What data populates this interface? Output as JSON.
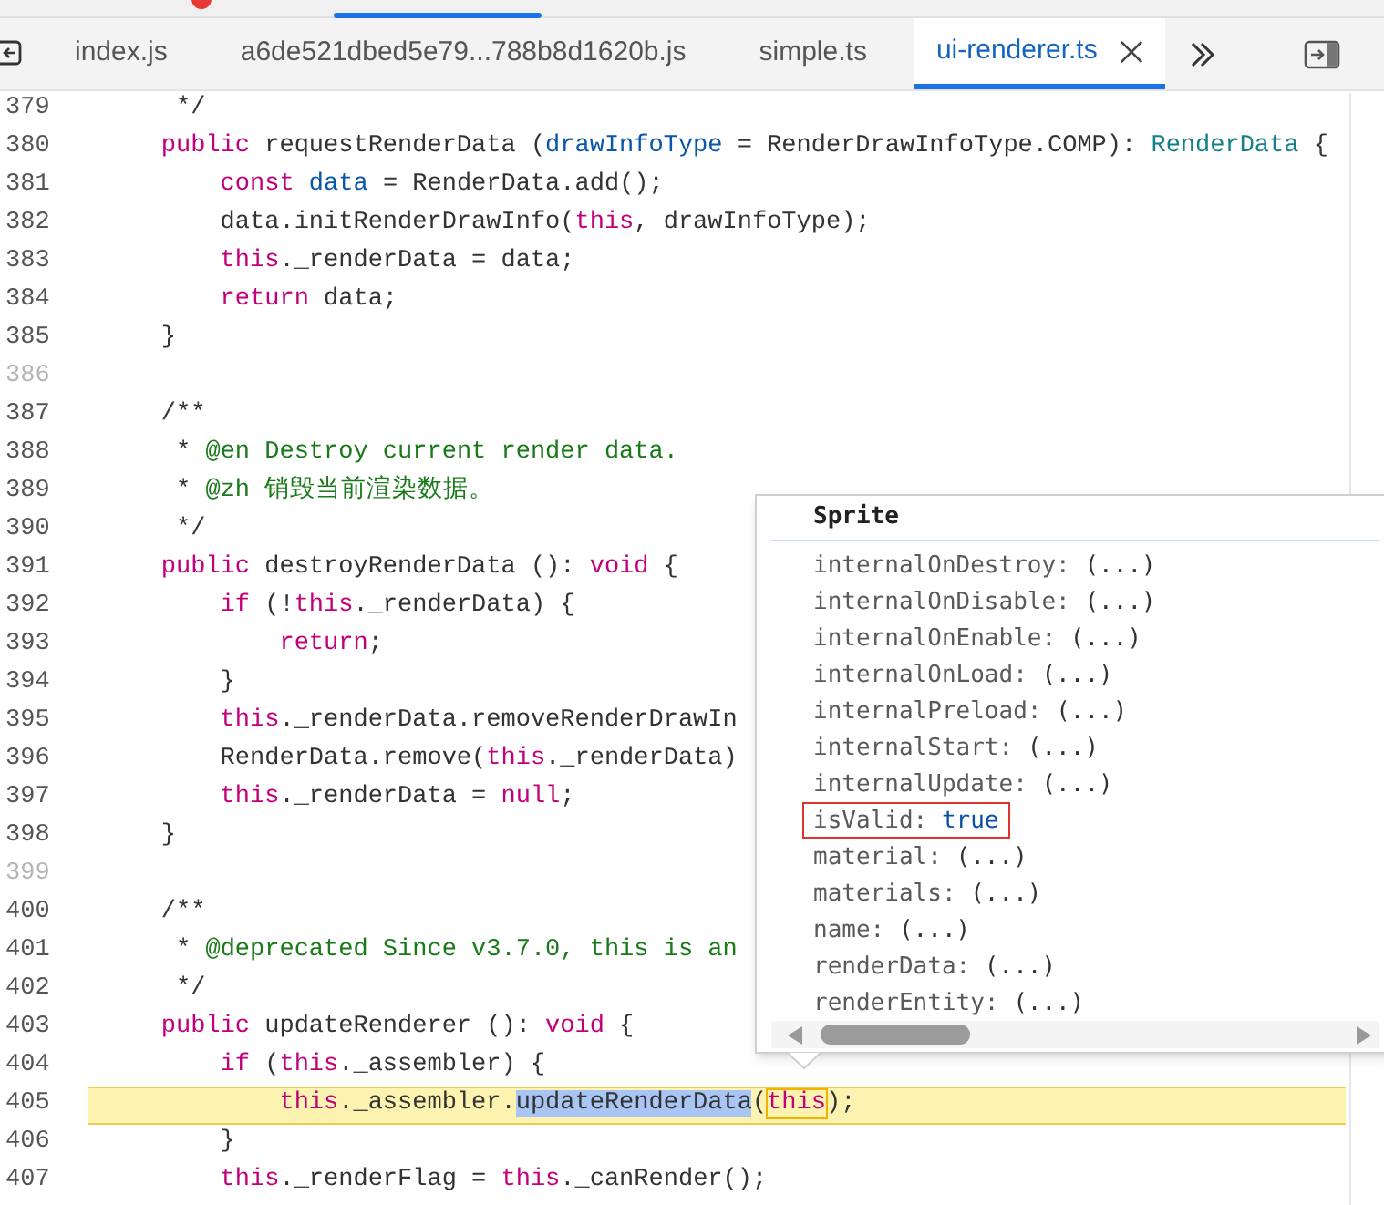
{
  "tab_bar": {
    "tabs": [
      {
        "label": "index.js",
        "selected": false
      },
      {
        "label": "a6de521dbed5e79...788b8d1620b.js",
        "selected": false
      },
      {
        "label": "simple.ts",
        "selected": false
      },
      {
        "label": "ui-renderer.ts",
        "selected": true
      }
    ]
  },
  "editor": {
    "lines": [
      {
        "number": "379",
        "highlighted": false,
        "tokens": [
          {
            "kind": "plain",
            "text": "     */"
          }
        ]
      },
      {
        "number": "380",
        "highlighted": false,
        "tokens": [
          {
            "kind": "keyword",
            "text": "    public"
          },
          {
            "kind": "plain",
            "text": " requestRenderData ("
          },
          {
            "kind": "variable",
            "text": "drawInfoType"
          },
          {
            "kind": "plain",
            "text": " = RenderDrawInfoType.COMP): "
          },
          {
            "kind": "type",
            "text": "RenderData"
          },
          {
            "kind": "plain",
            "text": " {"
          }
        ]
      },
      {
        "number": "381",
        "highlighted": false,
        "tokens": [
          {
            "kind": "keyword",
            "text": "        const"
          },
          {
            "kind": "variable",
            "text": " data"
          },
          {
            "kind": "plain",
            "text": " = RenderData.add();"
          }
        ]
      },
      {
        "number": "382",
        "highlighted": false,
        "tokens": [
          {
            "kind": "plain",
            "text": "        data.initRenderDrawInfo("
          },
          {
            "kind": "keyword",
            "text": "this"
          },
          {
            "kind": "plain",
            "text": ", drawInfoType);"
          }
        ]
      },
      {
        "number": "383",
        "highlighted": false,
        "tokens": [
          {
            "kind": "keyword",
            "text": "        this"
          },
          {
            "kind": "plain",
            "text": "._renderData = data;"
          }
        ]
      },
      {
        "number": "384",
        "highlighted": false,
        "tokens": [
          {
            "kind": "keyword",
            "text": "        return"
          },
          {
            "kind": "plain",
            "text": " data;"
          }
        ]
      },
      {
        "number": "385",
        "highlighted": false,
        "tokens": [
          {
            "kind": "plain",
            "text": "    }"
          }
        ]
      },
      {
        "number": "386",
        "highlighted": false
      },
      {
        "number": "387",
        "highlighted": false,
        "tokens": [
          {
            "kind": "plain",
            "text": "    /**"
          }
        ]
      },
      {
        "number": "388",
        "highlighted": false,
        "tokens": [
          {
            "kind": "plain",
            "text": "     * "
          },
          {
            "kind": "comment",
            "text": "@en Destroy current render data."
          }
        ]
      },
      {
        "number": "389",
        "highlighted": false,
        "tokens": [
          {
            "kind": "plain",
            "text": "     * "
          },
          {
            "kind": "comment",
            "text": "@zh 销毁当前渲染数据。"
          }
        ]
      },
      {
        "number": "390",
        "highlighted": false,
        "tokens": [
          {
            "kind": "plain",
            "text": "     */"
          }
        ]
      },
      {
        "number": "391",
        "highlighted": false,
        "tokens": [
          {
            "kind": "keyword",
            "text": "    public"
          },
          {
            "kind": "plain",
            "text": " destroyRenderData (): "
          },
          {
            "kind": "keyword",
            "text": "void"
          },
          {
            "kind": "plain",
            "text": " {"
          }
        ]
      },
      {
        "number": "392",
        "highlighted": false,
        "tokens": [
          {
            "kind": "keyword",
            "text": "        if"
          },
          {
            "kind": "plain",
            "text": " (!"
          },
          {
            "kind": "keyword",
            "text": "this"
          },
          {
            "kind": "plain",
            "text": "._renderData) {"
          }
        ]
      },
      {
        "number": "393",
        "highlighted": false,
        "tokens": [
          {
            "kind": "keyword",
            "text": "            return"
          },
          {
            "kind": "plain",
            "text": ";"
          }
        ]
      },
      {
        "number": "394",
        "highlighted": false,
        "tokens": [
          {
            "kind": "plain",
            "text": "        }"
          }
        ]
      },
      {
        "number": "395",
        "highlighted": false,
        "tokens": [
          {
            "kind": "keyword",
            "text": "        this"
          },
          {
            "kind": "plain",
            "text": "._renderData.removeRenderDrawIn"
          }
        ]
      },
      {
        "number": "396",
        "highlighted": false,
        "tokens": [
          {
            "kind": "plain",
            "text": "        RenderData.remove("
          },
          {
            "kind": "keyword",
            "text": "this"
          },
          {
            "kind": "plain",
            "text": "._renderData)"
          }
        ]
      },
      {
        "number": "397",
        "highlighted": false,
        "tokens": [
          {
            "kind": "keyword",
            "text": "        this"
          },
          {
            "kind": "plain",
            "text": "._renderData = "
          },
          {
            "kind": "keyword",
            "text": "null"
          },
          {
            "kind": "plain",
            "text": ";"
          }
        ]
      },
      {
        "number": "398",
        "highlighted": false,
        "tokens": [
          {
            "kind": "plain",
            "text": "    }"
          }
        ]
      },
      {
        "number": "399",
        "highlighted": false
      },
      {
        "number": "400",
        "highlighted": false,
        "tokens": [
          {
            "kind": "plain",
            "text": "    /**"
          }
        ]
      },
      {
        "number": "401",
        "highlighted": false,
        "tokens": [
          {
            "kind": "plain",
            "text": "     * "
          },
          {
            "kind": "comment",
            "text": "@deprecated Since v3.7.0, this is an"
          }
        ]
      },
      {
        "number": "402",
        "highlighted": false,
        "tokens": [
          {
            "kind": "plain",
            "text": "     */"
          }
        ]
      },
      {
        "number": "403",
        "highlighted": false,
        "tokens": [
          {
            "kind": "keyword",
            "text": "    public"
          },
          {
            "kind": "plain",
            "text": " updateRenderer (): "
          },
          {
            "kind": "keyword",
            "text": "void"
          },
          {
            "kind": "plain",
            "text": " {"
          }
        ]
      },
      {
        "number": "404",
        "highlighted": false,
        "tokens": [
          {
            "kind": "keyword",
            "text": "        if"
          },
          {
            "kind": "plain",
            "text": " ("
          },
          {
            "kind": "keyword",
            "text": "this"
          },
          {
            "kind": "plain",
            "text": "._assembler) {"
          }
        ]
      },
      {
        "number": "405",
        "highlighted": true,
        "tokens": [
          {
            "kind": "keyword",
            "text": "            this"
          },
          {
            "kind": "plain",
            "text": "._assembler."
          },
          {
            "kind": "selection",
            "text": "updateRenderData"
          },
          {
            "kind": "plain",
            "text": "("
          },
          {
            "kind": "boxed_keyword",
            "text": "this"
          },
          {
            "kind": "plain",
            "text": ");"
          }
        ]
      },
      {
        "number": "406",
        "highlighted": false,
        "tokens": [
          {
            "kind": "plain",
            "text": "        }"
          }
        ]
      },
      {
        "number": "407",
        "highlighted": false,
        "tokens": [
          {
            "kind": "keyword",
            "text": "        this"
          },
          {
            "kind": "plain",
            "text": "._renderFlag = "
          },
          {
            "kind": "keyword",
            "text": "this"
          },
          {
            "kind": "plain",
            "text": "._canRender();"
          }
        ]
      }
    ]
  },
  "hover_popup": {
    "title": "Sprite",
    "properties": [
      {
        "name": "internalOnDestroy:",
        "value": "(...)",
        "kind": "plain",
        "outlined": false
      },
      {
        "name": "internalOnDisable:",
        "value": "(...)",
        "kind": "plain",
        "outlined": false
      },
      {
        "name": "internalOnEnable:",
        "value": "(...)",
        "kind": "plain",
        "outlined": false
      },
      {
        "name": "internalOnLoad:",
        "value": "(...)",
        "kind": "plain",
        "outlined": false
      },
      {
        "name": "internalPreload:",
        "value": "(...)",
        "kind": "plain",
        "outlined": false
      },
      {
        "name": "internalStart:",
        "value": "(...)",
        "kind": "plain",
        "outlined": false
      },
      {
        "name": "internalUpdate:",
        "value": "(...)",
        "kind": "plain",
        "outlined": false
      },
      {
        "name": "isValid:",
        "value": "true",
        "kind": "boolean",
        "outlined": true
      },
      {
        "name": "material:",
        "value": "(...)",
        "kind": "plain",
        "outlined": false
      },
      {
        "name": "materials:",
        "value": "(...)",
        "kind": "plain",
        "outlined": false
      },
      {
        "name": "name:",
        "value": "(...)",
        "kind": "plain",
        "outlined": false
      },
      {
        "name": "renderData:",
        "value": "(...)",
        "kind": "plain",
        "outlined": false
      },
      {
        "name": "renderEntity:",
        "value": "(...)",
        "kind": "plain",
        "outlined": false
      }
    ]
  }
}
